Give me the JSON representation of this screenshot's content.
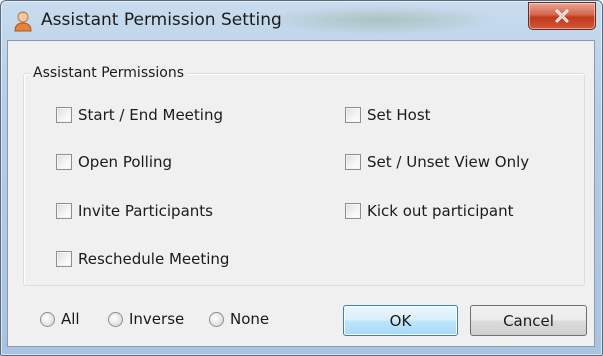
{
  "window": {
    "title": "Assistant Permission Setting",
    "app_icon": "user-icon",
    "close_icon": "close-icon"
  },
  "group": {
    "label": "Assistant Permissions",
    "permissions_left": [
      {
        "label": "Start / End Meeting",
        "checked": false
      },
      {
        "label": "Open Polling",
        "checked": false
      },
      {
        "label": "Invite Participants",
        "checked": false
      },
      {
        "label": "Reschedule Meeting",
        "checked": false
      }
    ],
    "permissions_right": [
      {
        "label": "Set Host",
        "checked": false
      },
      {
        "label": "Set / Unset View Only",
        "checked": false
      },
      {
        "label": "Kick out participant",
        "checked": false
      }
    ]
  },
  "selection": {
    "all_label": "All",
    "inverse_label": "Inverse",
    "none_label": "None"
  },
  "buttons": {
    "ok_label": "OK",
    "cancel_label": "Cancel"
  }
}
